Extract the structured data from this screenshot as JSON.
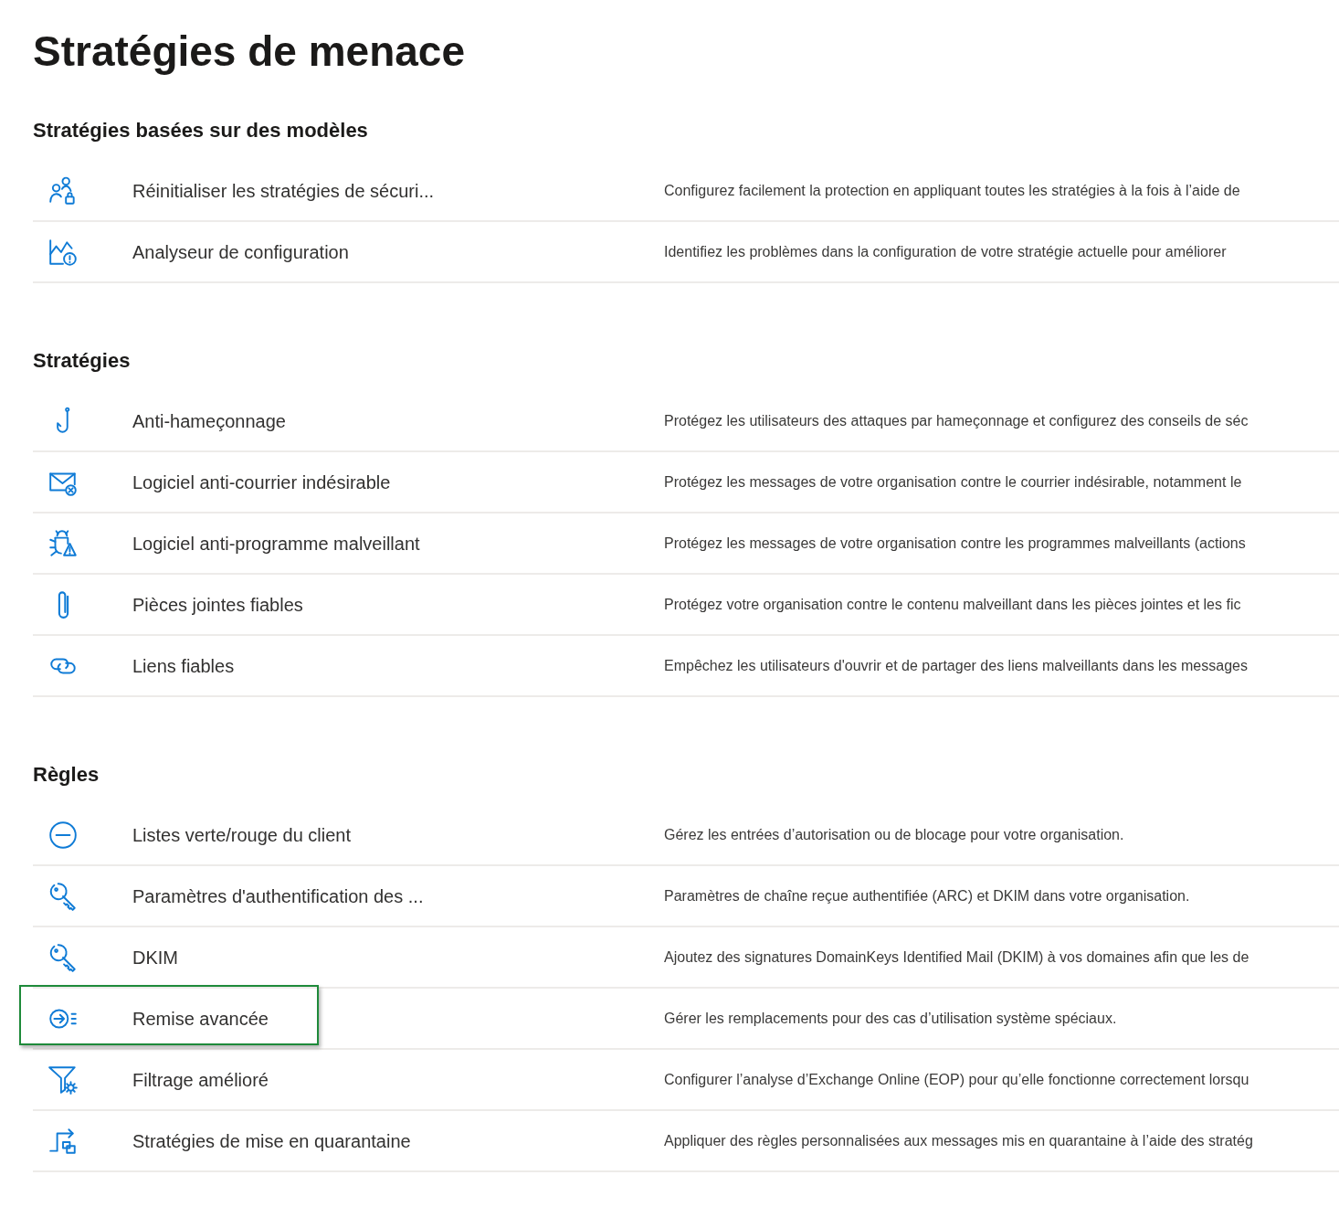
{
  "title": "Stratégies de menace",
  "sections": [
    {
      "heading": "Stratégies basées sur des modèles",
      "items": [
        {
          "kind": "people-lock",
          "name": "Réinitialiser les stratégies de sécuri...",
          "description": "Configurez facilement la protection en appliquant toutes les stratégies à la fois à l’aide de",
          "highlighted": false
        },
        {
          "kind": "chart-alert",
          "name": "Analyseur de configuration",
          "description": "Identifiez les problèmes dans la configuration de votre stratégie actuelle pour améliorer",
          "highlighted": false
        }
      ]
    },
    {
      "heading": "Stratégies",
      "items": [
        {
          "kind": "hook",
          "name": "Anti-hameçonnage",
          "description": "Protégez les utilisateurs des attaques par hameçonnage et configurez des conseils de séc",
          "highlighted": false
        },
        {
          "kind": "mail-x",
          "name": "Logiciel anti-courrier indésirable",
          "description": "Protégez les messages de votre organisation contre le courrier indésirable, notamment le",
          "highlighted": false
        },
        {
          "kind": "bug",
          "name": "Logiciel anti-programme malveillant",
          "description": "Protégez les messages de votre organisation contre les programmes malveillants (actions",
          "highlighted": false
        },
        {
          "kind": "clip",
          "name": "Pièces jointes fiables",
          "description": "Protégez votre organisation contre le contenu malveillant dans les pièces jointes et les fic",
          "highlighted": false
        },
        {
          "kind": "link",
          "name": "Liens fiables",
          "description": "Empêchez les utilisateurs d'ouvrir et de partager des liens malveillants dans les messages",
          "highlighted": false
        }
      ]
    },
    {
      "heading": "Règles",
      "items": [
        {
          "kind": "minus-circle",
          "name": "Listes verte/rouge du client",
          "description": "Gérez les entrées d’autorisation ou de blocage pour votre organisation.",
          "highlighted": false
        },
        {
          "kind": "key",
          "name": "Paramètres d'authentification des ...",
          "description": "Paramètres de chaîne reçue authentifiée (ARC) et DKIM dans votre organisation.",
          "highlighted": false
        },
        {
          "kind": "key",
          "name": "DKIM",
          "description": "Ajoutez des signatures DomainKeys Identified Mail (DKIM) à vos domaines afin que les de",
          "highlighted": false
        },
        {
          "kind": "arrow-list",
          "name": "Remise avancée",
          "description": "Gérer les remplacements pour des cas d’utilisation système spéciaux.",
          "highlighted": true
        },
        {
          "kind": "filter-gear",
          "name": "Filtrage amélioré",
          "description": "Configurer l’analyse d’Exchange Online (EOP) pour qu’elle fonctionne correctement lorsqu",
          "highlighted": false
        },
        {
          "kind": "flow",
          "name": "Stratégies de mise en quarantaine",
          "description": "Appliquer des règles personnalisées aux messages mis en quarantaine à l’aide des stratég",
          "highlighted": false
        }
      ]
    }
  ]
}
